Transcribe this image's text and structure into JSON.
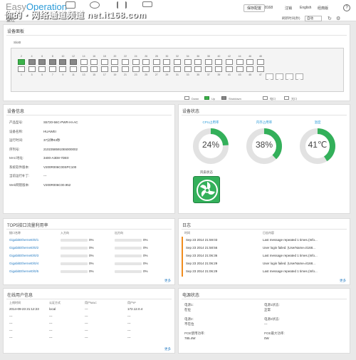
{
  "header": {
    "brand_prefix": "Easy",
    "brand_suffix": "Operation",
    "watermark": "你的・网络通道频道 net.it168.com",
    "nav_label": "监控",
    "save_button": "保存配置",
    "user": "8168",
    "logout": "注销",
    "lang_en": "English",
    "lang_classic": "经典版",
    "help": "?"
  },
  "subbar": {
    "title": "监控",
    "refresh_label": "刷新时间(秒)",
    "refresh_value": "自动"
  },
  "device_panel": {
    "title": "设备面板",
    "stack_label": "Slot0",
    "top_numbers": [
      "2",
      "4",
      "6",
      "8",
      "10",
      "12",
      "14",
      "16",
      "18",
      "20",
      "22",
      "24",
      "26",
      "28",
      "30",
      "32",
      "34",
      "36",
      "38",
      "40",
      "42",
      "44",
      "46",
      "48"
    ],
    "bottom_numbers": [
      "1",
      "3",
      "5",
      "7",
      "9",
      "11",
      "13",
      "15",
      "17",
      "19",
      "21",
      "23",
      "25",
      "27",
      "29",
      "31",
      "33",
      "35",
      "37",
      "39",
      "41",
      "43",
      "45",
      "47"
    ],
    "top_states": [
      "up",
      "down",
      "down",
      "down",
      "down",
      "down",
      "empty",
      "empty",
      "empty",
      "empty",
      "empty",
      "empty",
      "empty",
      "empty",
      "empty",
      "empty",
      "empty",
      "empty",
      "empty",
      "empty",
      "empty",
      "empty",
      "empty",
      "empty"
    ],
    "bottom_states": [
      "empty",
      "empty",
      "empty",
      "empty",
      "empty",
      "empty",
      "empty",
      "empty",
      "empty",
      "empty",
      "empty",
      "empty",
      "empty",
      "empty",
      "empty",
      "empty",
      "empty",
      "empty",
      "empty",
      "empty",
      "empty",
      "empty",
      "empty",
      "empty"
    ],
    "legend": {
      "down_label": "Down",
      "up_label": "Up",
      "shutdown_label": "Shutdown",
      "copper_label": "电口",
      "fiber_label": "光口"
    }
  },
  "device_info": {
    "title": "设备信息",
    "rows": [
      {
        "key": "产品型号:",
        "value": "S5720-56C-PWR-HI-AC"
      },
      {
        "key": "设备名称:",
        "value": "HUAWEI"
      },
      {
        "key": "运行时间:",
        "value": "37分钟43秒"
      },
      {
        "key": "序列号:",
        "value": "21023585910E6000002"
      },
      {
        "key": "MAC地址:",
        "value": "3400-A3D8-7DE0"
      },
      {
        "key": "系统软件版本:",
        "value": "V200R006C00SPC100"
      },
      {
        "key": "当前运行补丁:",
        "value": "---"
      },
      {
        "key": "Web网管版本:",
        "value": "V200R006C00.952"
      }
    ]
  },
  "device_status": {
    "title": "设备状态",
    "cpu_label": "CPU占用率",
    "cpu_value": "24%",
    "cpu_fraction": 0.24,
    "mem_label": "内存占用率",
    "mem_value": "38%",
    "mem_fraction": 0.38,
    "temp_label": "温度",
    "temp_value": "41℃",
    "temp_fraction": 0.41,
    "fan_label": "风扇状态",
    "accent": "#33b05a"
  },
  "top5": {
    "title": "TOP5接口流量利用率",
    "headers": [
      "接口名称",
      "入方向",
      "出方向"
    ],
    "rows": [
      {
        "name": "GigabitEthernet0/0/1",
        "in": "0%",
        "out": "0%"
      },
      {
        "name": "GigabitEthernet0/0/2",
        "in": "0%",
        "out": "0%"
      },
      {
        "name": "GigabitEthernet0/0/3",
        "in": "0%",
        "out": "0%"
      },
      {
        "name": "GigabitEthernet0/0/4",
        "in": "0%",
        "out": "0%"
      },
      {
        "name": "GigabitEthernet0/0/5",
        "in": "0%",
        "out": "0%"
      }
    ],
    "more": "更多"
  },
  "log": {
    "title": "日志",
    "headers": [
      "时间",
      "日志内容"
    ],
    "rows": [
      {
        "time": "Sep 23 2014 21:59:03",
        "msg": "Last message repeated 1 times.(Info..."
      },
      {
        "time": "Sep 23 2014 21:58:56",
        "msg": "User login failed. (UserName=it168..."
      },
      {
        "time": "Sep 23 2014 21:06:36",
        "msg": "Last message repeated 1 times.(Info..."
      },
      {
        "time": "Sep 23 2014 21:06:29",
        "msg": "User login failed. (UserName=it168..."
      },
      {
        "time": "Sep 23 2014 21:06:29",
        "msg": "Last message repeated 1 times.(Info..."
      }
    ],
    "more": "更多"
  },
  "online_users": {
    "title": "在线用户信息",
    "headers": [
      "上线时间",
      "认证方式",
      "用户MAC",
      "用户IP"
    ],
    "rows": [
      {
        "time": "2014-09-23 21:12:23",
        "auth": "local",
        "mac": "---",
        "ip": "172.12.0.4"
      },
      {
        "time": "---",
        "auth": "---",
        "mac": "---",
        "ip": "---"
      },
      {
        "time": "---",
        "auth": "---",
        "mac": "---",
        "ip": "---"
      },
      {
        "time": "---",
        "auth": "---",
        "mac": "---",
        "ip": "---"
      },
      {
        "time": "---",
        "auth": "---",
        "mac": "---",
        "ip": "---"
      }
    ],
    "more": "更多"
  },
  "power": {
    "title": "电源状态",
    "items": [
      {
        "key": "电源1:",
        "value": "在位"
      },
      {
        "key": "电源1状态:",
        "value": "正常"
      },
      {
        "key": "电源2:",
        "value": "不在位"
      },
      {
        "key": "电源2状态:",
        "value": "---"
      },
      {
        "key": "POE使用功率:",
        "value": "785.4W"
      },
      {
        "key": "POE最大功率:",
        "value": "0W"
      }
    ]
  }
}
